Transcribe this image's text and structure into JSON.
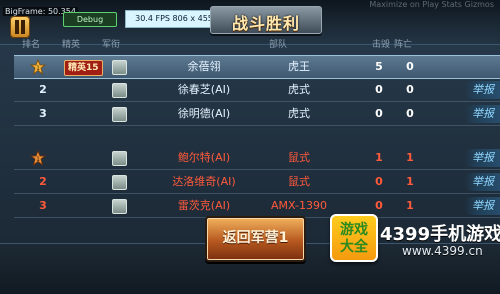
{
  "hud": {
    "bigframe": "BigFrame: 50.354",
    "debug_label": "Debug",
    "fps_text": "30.4 FPS 806 x 455",
    "banner_title": "战斗胜利",
    "right_faint": "Maximize on Play  Stats  Gizmos"
  },
  "headers": {
    "rank": "排名",
    "elite": "精英",
    "army": "军衔",
    "name": "",
    "corps": "部队",
    "kill": "击毁",
    "death": "阵亡"
  },
  "colors": {
    "team_blue": "#e5f2ff",
    "team_red": "#ff5a3b",
    "report": "#8fd6ff"
  },
  "blue_team": [
    {
      "rank": "",
      "elite": "精英15",
      "name": "余蓓翎",
      "corps": "虎王",
      "kill": "5",
      "death": "0",
      "report": "",
      "medal": true,
      "self": true
    },
    {
      "rank": "2",
      "elite": "",
      "name": "徐春芝(AI)",
      "corps": "虎式",
      "kill": "0",
      "death": "0",
      "report": "举报",
      "medal": false,
      "self": false
    },
    {
      "rank": "3",
      "elite": "",
      "name": "徐明德(AI)",
      "corps": "虎式",
      "kill": "0",
      "death": "0",
      "report": "举报",
      "medal": false,
      "self": false
    }
  ],
  "red_team": [
    {
      "rank": "",
      "elite": "",
      "name": "鲍尔特(AI)",
      "corps": "鼠式",
      "kill": "1",
      "death": "1",
      "report": "举报",
      "medal": true
    },
    {
      "rank": "2",
      "elite": "",
      "name": "达洛维奇(AI)",
      "corps": "鼠式",
      "kill": "0",
      "death": "1",
      "report": "举报",
      "medal": false
    },
    {
      "rank": "3",
      "elite": "",
      "name": "雷茨克(AI)",
      "corps": "AMX-1390",
      "kill": "0",
      "death": "1",
      "report": "举报",
      "medal": false
    }
  ],
  "footer": {
    "return_button": "返回军营1",
    "logo_line1": "游戏",
    "logo_line2": "大全",
    "logo_title": "4399手机游戏网",
    "logo_url": "www.4399.cn"
  }
}
